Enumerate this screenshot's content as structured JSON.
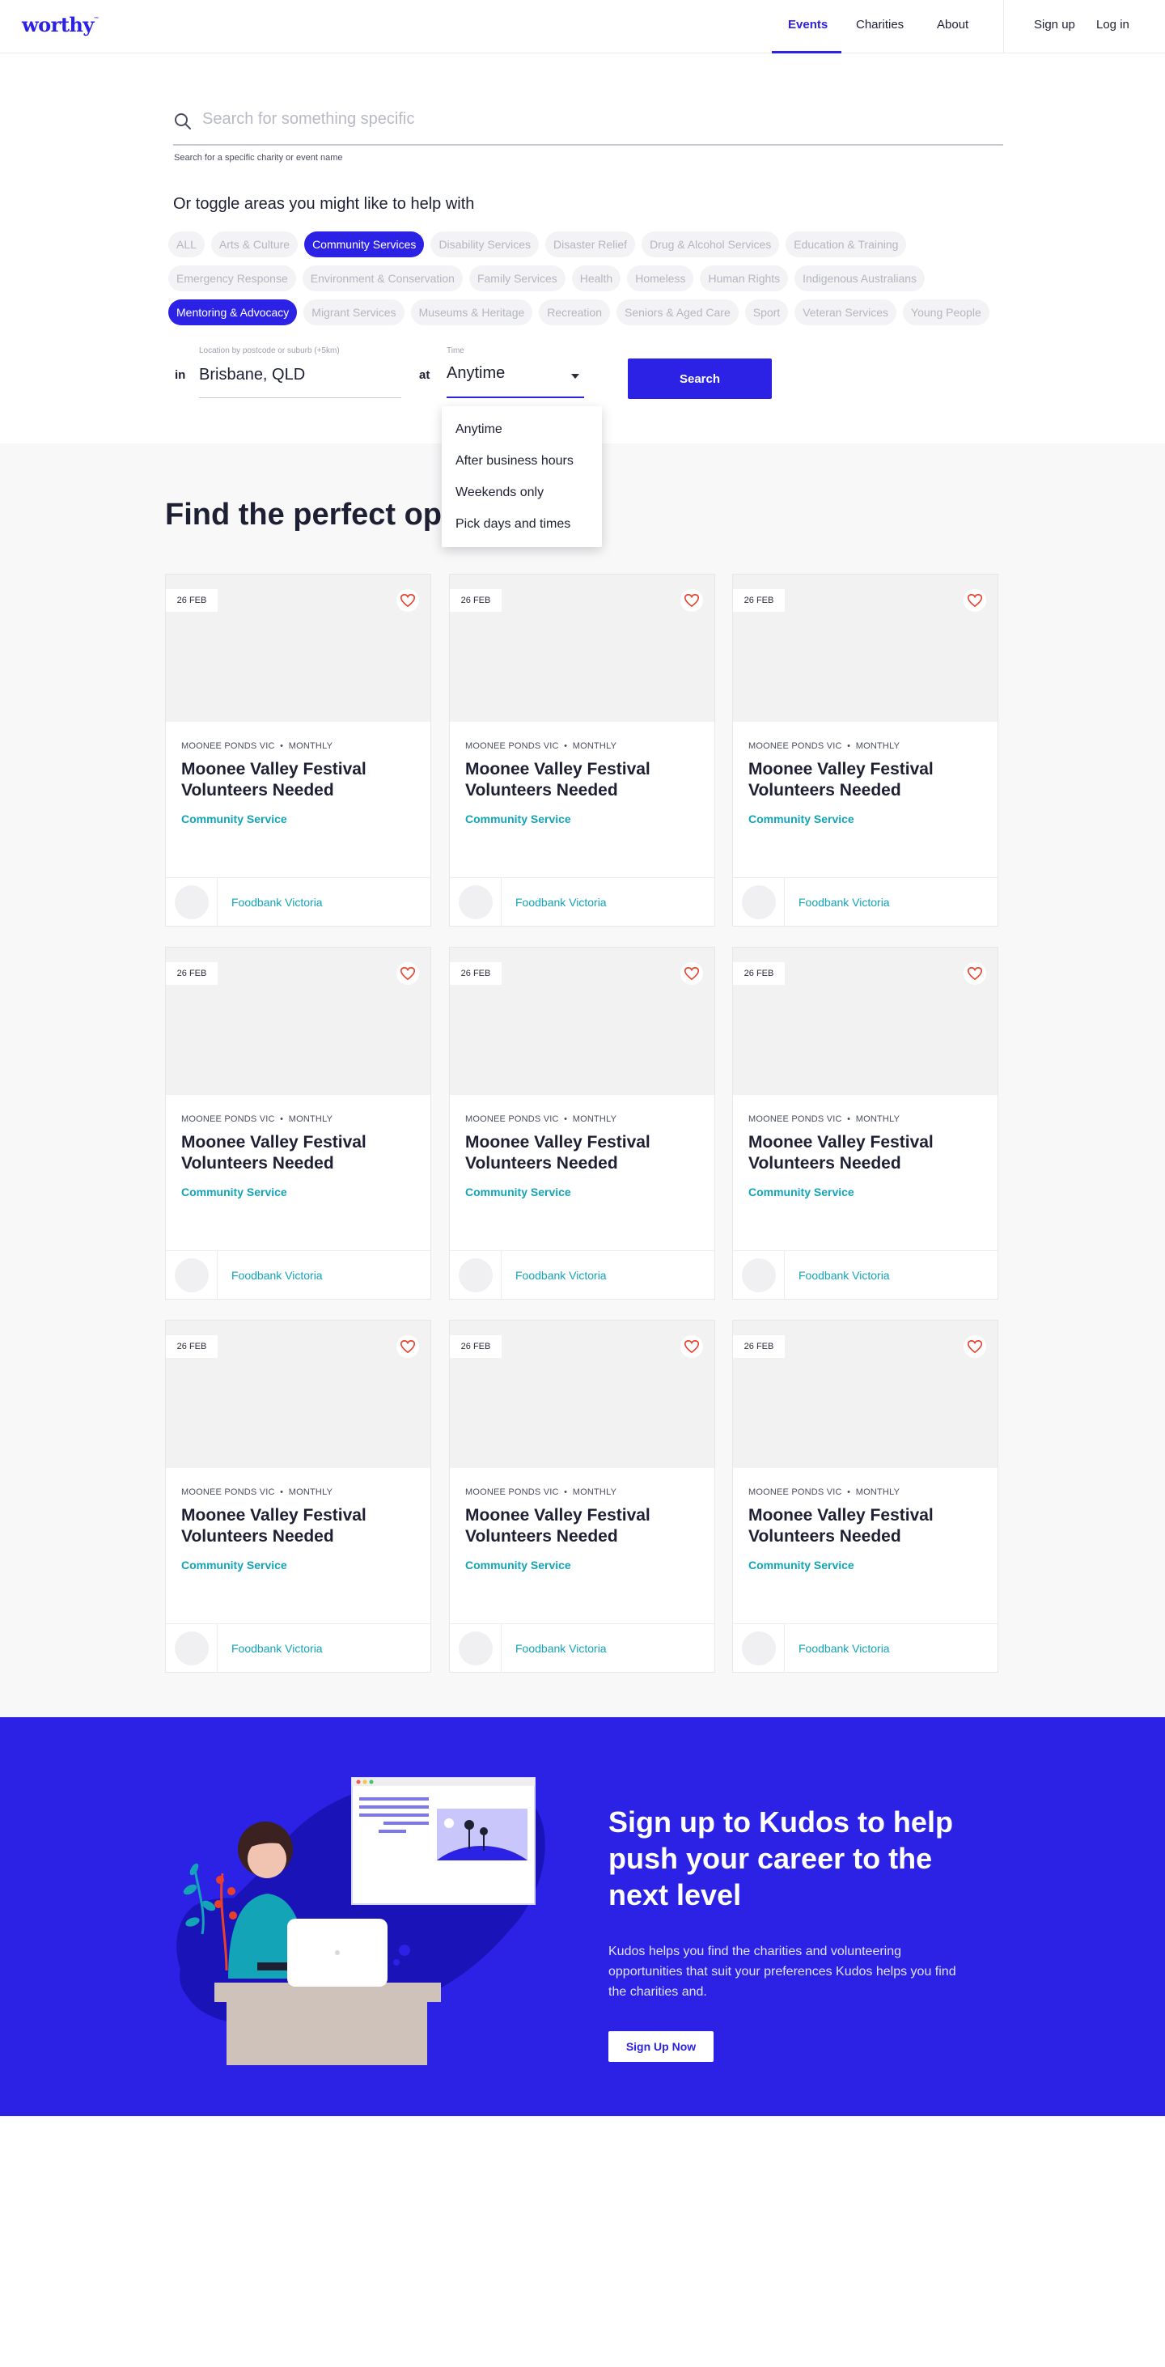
{
  "nav": {
    "logo": "worthy",
    "logo_mark": "™",
    "links": [
      "Events",
      "Charities",
      "About"
    ],
    "auth": [
      "Sign up",
      "Log in"
    ]
  },
  "search": {
    "placeholder": "Search for something specific",
    "help": "Search for a specific charity or event name"
  },
  "toggle_heading": "Or toggle areas you might like to help with",
  "chips": [
    [
      {
        "label": "ALL",
        "on": false
      },
      {
        "label": "Arts & Culture",
        "on": false
      },
      {
        "label": "Community Services",
        "on": true
      },
      {
        "label": "Disability Services",
        "on": false
      },
      {
        "label": "Disaster Relief",
        "on": false
      },
      {
        "label": "Drug & Alcohol Services",
        "on": false
      },
      {
        "label": "Education & Training",
        "on": false
      }
    ],
    [
      {
        "label": "Emergency Response",
        "on": false
      },
      {
        "label": "Environment & Conservation",
        "on": false
      },
      {
        "label": "Family Services",
        "on": false
      },
      {
        "label": "Health",
        "on": false
      },
      {
        "label": "Homeless",
        "on": false
      },
      {
        "label": "Human Rights",
        "on": false
      },
      {
        "label": "Indigenous Australians",
        "on": false
      }
    ],
    [
      {
        "label": "Mentoring & Advocacy",
        "on": true
      },
      {
        "label": "Migrant Services",
        "on": false
      },
      {
        "label": "Museums & Heritage",
        "on": false
      },
      {
        "label": "Recreation",
        "on": false
      },
      {
        "label": "Seniors & Aged Care",
        "on": false
      },
      {
        "label": "Sport",
        "on": false
      },
      {
        "label": "Veteran Services",
        "on": false
      },
      {
        "label": "Young People",
        "on": false
      }
    ]
  ],
  "filters": {
    "in_label": "in",
    "location_caption": "Location by postcode or suburb (+5km)",
    "location_value": "Brisbane, QLD",
    "at_label": "at",
    "time_caption": "Time",
    "time_value": "Anytime",
    "search_button": "Search",
    "time_options": [
      "Anytime",
      "After business hours",
      "Weekends only",
      "Pick days and times"
    ]
  },
  "grid_title": "Find the perfect opportunity",
  "cards": [
    {
      "date": "26 FEB",
      "location": "MOONEE PONDS VIC",
      "frequency": "MONTHLY",
      "title": "Moonee Valley Festival Volunteers Needed",
      "category": "Community Service",
      "org": "Foodbank Victoria"
    },
    {
      "date": "26 FEB",
      "location": "MOONEE PONDS VIC",
      "frequency": "MONTHLY",
      "title": "Moonee Valley Festival Volunteers Needed",
      "category": "Community Service",
      "org": "Foodbank Victoria"
    },
    {
      "date": "26 FEB",
      "location": "MOONEE PONDS VIC",
      "frequency": "MONTHLY",
      "title": "Moonee Valley Festival Volunteers Needed",
      "category": "Community Service",
      "org": "Foodbank Victoria"
    },
    {
      "date": "26 FEB",
      "location": "MOONEE PONDS VIC",
      "frequency": "MONTHLY",
      "title": "Moonee Valley Festival Volunteers Needed",
      "category": "Community Service",
      "org": "Foodbank Victoria"
    },
    {
      "date": "26 FEB",
      "location": "MOONEE PONDS VIC",
      "frequency": "MONTHLY",
      "title": "Moonee Valley Festival Volunteers Needed",
      "category": "Community Service",
      "org": "Foodbank Victoria"
    },
    {
      "date": "26 FEB",
      "location": "MOONEE PONDS VIC",
      "frequency": "MONTHLY",
      "title": "Moonee Valley Festival Volunteers Needed",
      "category": "Community Service",
      "org": "Foodbank Victoria"
    },
    {
      "date": "26 FEB",
      "location": "MOONEE PONDS VIC",
      "frequency": "MONTHLY",
      "title": "Moonee Valley Festival Volunteers Needed",
      "category": "Community Service",
      "org": "Foodbank Victoria"
    },
    {
      "date": "26 FEB",
      "location": "MOONEE PONDS VIC",
      "frequency": "MONTHLY",
      "title": "Moonee Valley Festival Volunteers Needed",
      "category": "Community Service",
      "org": "Foodbank Victoria"
    },
    {
      "date": "26 FEB",
      "location": "MOONEE PONDS VIC",
      "frequency": "MONTHLY",
      "title": "Moonee Valley Festival Volunteers Needed",
      "category": "Community Service",
      "org": "Foodbank Victoria"
    }
  ],
  "cta": {
    "title": "Sign up to Kudos to help push your career to the next level",
    "text": "Kudos helps you find the charities and volunteering opportunities that suit your preferences Kudos helps you find the charities and.",
    "button": "Sign Up Now"
  },
  "colors": {
    "brand": "#2b22e6",
    "teal": "#13a4b8",
    "heart": "#e8402c"
  },
  "icons": {
    "search": "search-icon",
    "favorite": "heart-icon",
    "dropdown": "chevron-down-icon"
  }
}
